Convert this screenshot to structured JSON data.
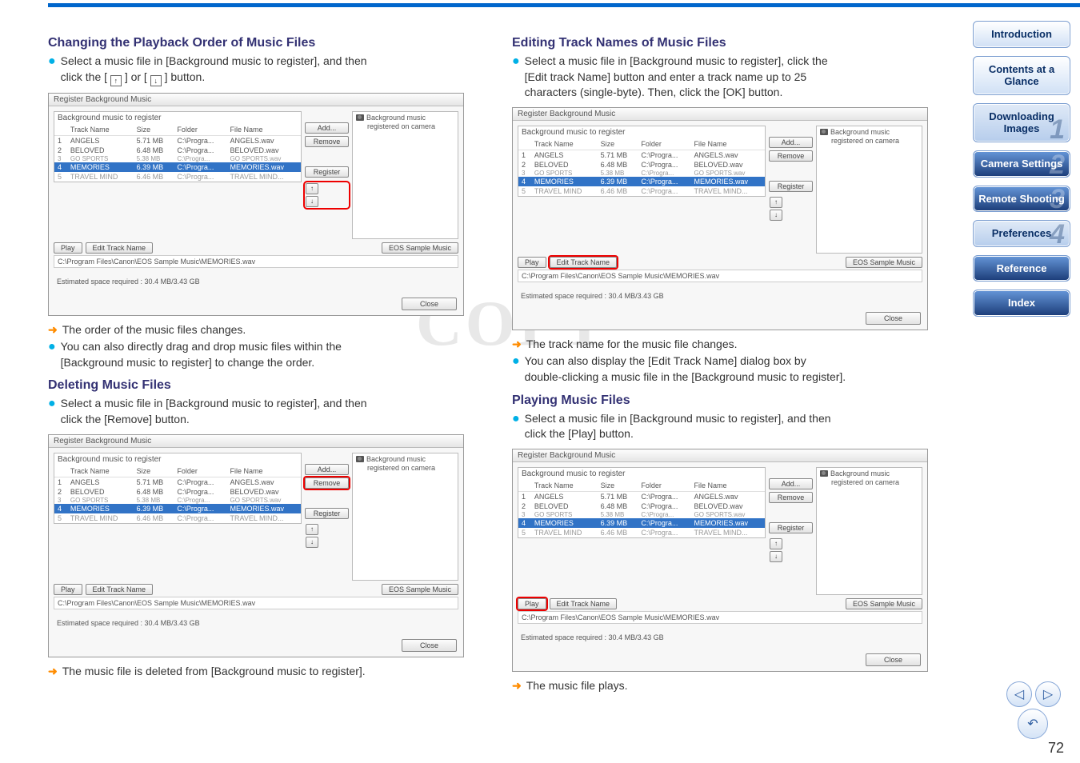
{
  "page_number": "72",
  "sidebar": {
    "items": [
      {
        "label": "Introduction",
        "num": ""
      },
      {
        "label": "Contents at a Glance",
        "num": ""
      },
      {
        "label": "Downloading Images",
        "num": "1"
      },
      {
        "label": "Camera Settings",
        "num": "2"
      },
      {
        "label": "Remote Shooting",
        "num": "3"
      },
      {
        "label": "Preferences",
        "num": "4"
      },
      {
        "label": "Reference",
        "num": ""
      },
      {
        "label": "Index",
        "num": ""
      }
    ]
  },
  "left": {
    "h1": "Changing the Playback Order of Music Files",
    "p1a": "Select a music file in [Background music to register], and then",
    "p1b": "click the [",
    "p1c": "] or [",
    "p1d": "] button.",
    "res1": "The order of the music files changes.",
    "bullet2a": "You can also directly drag and drop music files within the",
    "bullet2b": "[Background music to register] to change the order.",
    "h2": "Deleting Music Files",
    "p2a": "Select a music file in [Background music to register], and then",
    "p2b": "click the [Remove] button.",
    "res2": "The music file is deleted from [Background music to register]."
  },
  "right": {
    "h1": "Editing Track Names of Music Files",
    "p1a": "Select a music file in [Background music to register], click the",
    "p1b": "[Edit track Name] button and enter a track name up to 25",
    "p1c": "characters (single-byte). Then, click the [OK] button.",
    "res1": "The track name for the music file changes.",
    "bullet2a": "You can also display the [Edit Track Name] dialog box by",
    "bullet2b": "double-clicking a music file in the [Background music to register].",
    "h2": "Playing Music Files",
    "p2a": "Select a music file in [Background music to register], and then",
    "p2b": "click the [Play] button.",
    "res2": "The music file plays."
  },
  "dialog": {
    "title": "Register Background Music",
    "group": "Background music to register",
    "cols": {
      "track": "Track Name",
      "size": "Size",
      "folder": "Folder",
      "file": "File Name"
    },
    "rows": [
      {
        "n": "1",
        "track": "ANGELS",
        "size": "5.71 MB",
        "folder": "C:\\Progra...",
        "file": "ANGELS.wav"
      },
      {
        "n": "2",
        "track": "BELOVED",
        "size": "6.48 MB",
        "folder": "C:\\Progra...",
        "file": "BELOVED.wav"
      },
      {
        "n": "3",
        "track": "GO SPORTS",
        "size": "5.38 MB",
        "folder": "C:\\Progra...",
        "file": "GO SPORTS.wav"
      },
      {
        "n": "4",
        "track": "MEMORIES",
        "size": "6.39 MB",
        "folder": "C:\\Progra...",
        "file": "MEMORIES.wav"
      },
      {
        "n": "5",
        "track": "TRAVEL MIND",
        "size": "6.46 MB",
        "folder": "C:\\Progra...",
        "file": "TRAVEL MIND..."
      }
    ],
    "add": "Add...",
    "remove": "Remove",
    "register": "Register",
    "play": "Play",
    "edit": "Edit Track Name",
    "eos": "EOS Sample Music",
    "path": "C:\\Program Files\\Canon\\EOS Sample Music\\MEMORIES.wav",
    "est": "Estimated space required : 30.4 MB/3.43 GB",
    "close": "Close",
    "right_label": "Background music",
    "right_sub": "registered on camera"
  },
  "icons": {
    "up": "↑",
    "down": "↓"
  },
  "watermark": "COPY"
}
